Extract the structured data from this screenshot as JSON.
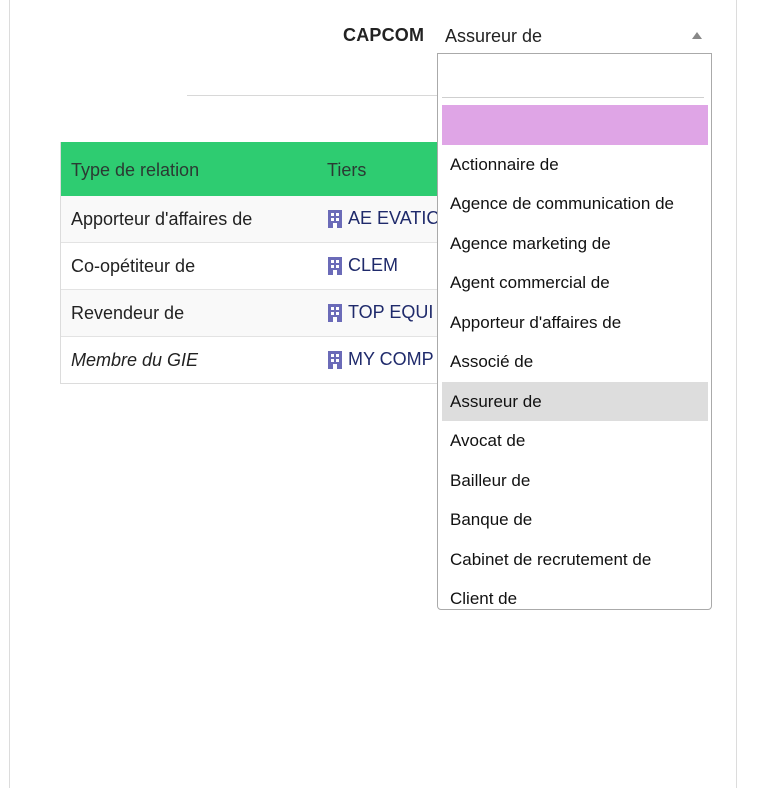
{
  "form": {
    "company_label": "CAPCOM",
    "selected_relation": "Assureur de"
  },
  "table": {
    "headers": [
      "Type de relation",
      "Tiers"
    ],
    "rows": [
      {
        "relation": "Apporteur d'affaires de",
        "tiers": "AE EVATIC"
      },
      {
        "relation": "Co-opétiteur de",
        "tiers": "CLEM"
      },
      {
        "relation": "Revendeur de",
        "tiers": "TOP EQUI"
      },
      {
        "relation": "Membre du GIE",
        "tiers": "MY COMP"
      }
    ]
  },
  "dropdown": {
    "search_value": "",
    "options": [
      "",
      "Actionnaire de",
      "Agence de communication de",
      "Agence marketing de",
      "Agent commercial de",
      "Apporteur d'affaires de",
      "Associé de",
      "Assureur de",
      "Avocat de",
      "Bailleur de",
      "Banque de",
      "Cabinet de recrutement de",
      "Client de"
    ]
  },
  "colors": {
    "table_header": "#2ecc71",
    "highlight_empty": "#dfa5e6",
    "highlight_selected": "#dddddd",
    "link": "#1f2a6b",
    "building_icon": "#6b6bb8"
  },
  "icons": {
    "tiers": "building-icon",
    "select": "triangle-up-icon"
  }
}
